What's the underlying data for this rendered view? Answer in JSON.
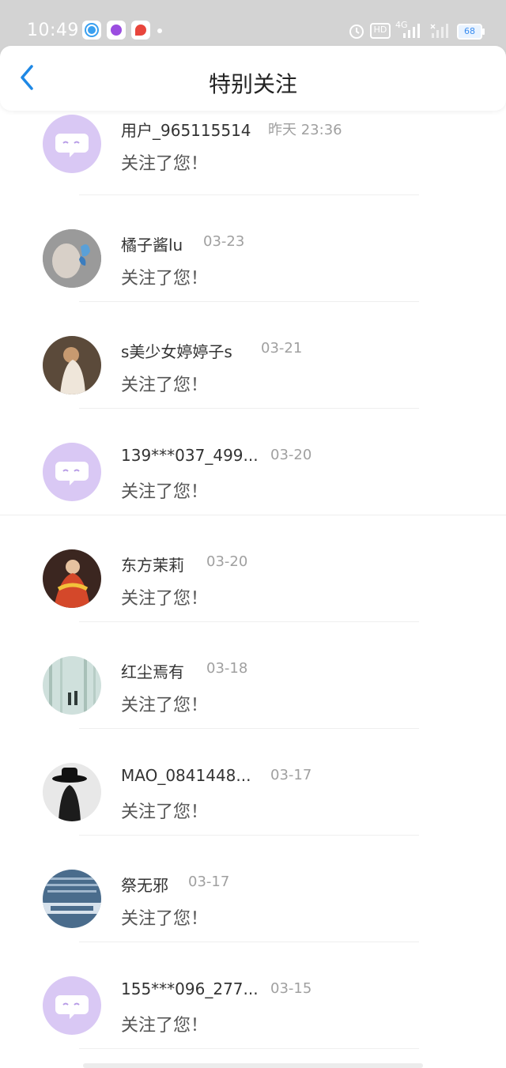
{
  "status_bar": {
    "time": "10:49",
    "hd_label": "HD",
    "network_label": "4G",
    "battery": "68"
  },
  "header": {
    "title": "特别关注",
    "back_icon": "chevron-left-icon"
  },
  "colors": {
    "accent": "#1e88e5",
    "default_avatar": "#d9c8f4",
    "status_bar": "#d3d3d3"
  },
  "notifications": [
    {
      "name": "用户_965115514",
      "date": "昨天 23:36",
      "message": "关注了您！",
      "avatar": "default"
    },
    {
      "name": "橘子酱lu",
      "date": "03-23",
      "message": "关注了您！",
      "avatar": "butterfly-photo"
    },
    {
      "name": "s美少女婷婷子s",
      "date": "03-21",
      "message": "关注了您！",
      "avatar": "girl-photo"
    },
    {
      "name": "139***037_499...",
      "date": "03-20",
      "message": "关注了您！",
      "avatar": "default"
    },
    {
      "name": "东方茉莉",
      "date": "03-20",
      "message": "关注了您！",
      "avatar": "costume-photo"
    },
    {
      "name": "红尘焉有",
      "date": "03-18",
      "message": "关注了您！",
      "avatar": "forest-photo"
    },
    {
      "name": "MAO_0841448...",
      "date": "03-17",
      "message": "关注了您！",
      "avatar": "hat-photo"
    },
    {
      "name": "祭无邪",
      "date": "03-17",
      "message": "关注了您！",
      "avatar": "study-photo"
    },
    {
      "name": "155***096_277...",
      "date": "03-15",
      "message": "关注了您！",
      "avatar": "default"
    }
  ]
}
